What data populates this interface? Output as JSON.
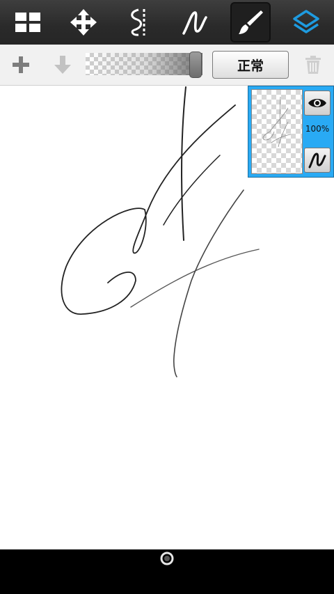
{
  "toolbar": {
    "tools": [
      {
        "id": "menu",
        "icon": "grid-menu-icon"
      },
      {
        "id": "move",
        "icon": "move-arrows-icon"
      },
      {
        "id": "symmetry",
        "icon": "symmetry-icon"
      },
      {
        "id": "stabilizer",
        "icon": "stroke-correction-icon"
      },
      {
        "id": "brush",
        "icon": "brush-icon",
        "active": true
      },
      {
        "id": "layers",
        "icon": "layers-icon",
        "accent": "#1e9be0"
      }
    ]
  },
  "layer_bar": {
    "add_icon": "plus-icon",
    "merge_down_icon": "arrow-down-icon",
    "opacity_value": 1.0,
    "blend_mode": "正常",
    "delete_icon": "trash-icon"
  },
  "layer_panel": {
    "opacity_label": "100%",
    "visibility_icon": "eye-icon",
    "mode_icon": "stroke-icon",
    "highlight_color": "#29aaf4"
  },
  "navbar": {
    "home_icon": "home-circle-icon"
  }
}
